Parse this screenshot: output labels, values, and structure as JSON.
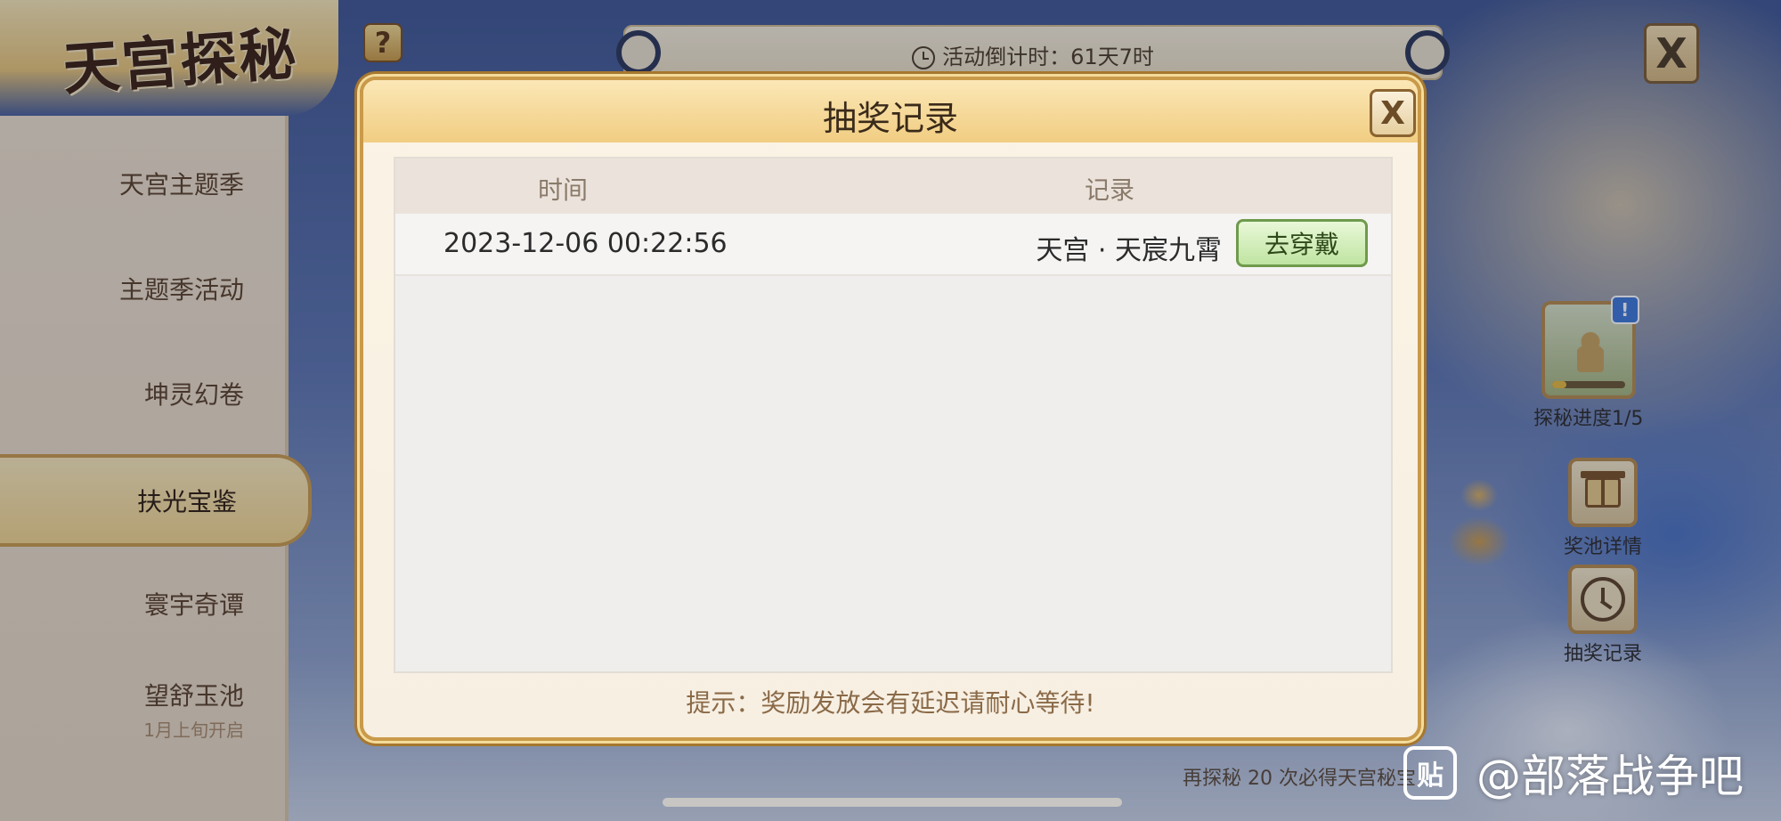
{
  "app": {
    "logo_text": "天宫探秘",
    "help_icon": "question-icon",
    "countdown": "活动倒计时：61天7时",
    "close_icon": "close-icon"
  },
  "sidebar": {
    "items": [
      {
        "label": "天宫主题季",
        "sub": "",
        "active": false
      },
      {
        "label": "主题季活动",
        "sub": "",
        "active": false
      },
      {
        "label": "坤灵幻卷",
        "sub": "",
        "active": false
      },
      {
        "label": "扶光宝鉴",
        "sub": "",
        "active": true
      },
      {
        "label": "寰宇奇谭",
        "sub": "",
        "active": false
      },
      {
        "label": "望舒玉池",
        "sub": "1月上旬开启",
        "active": false
      }
    ]
  },
  "right_panel": {
    "progress": {
      "label": "探秘进度1/5",
      "value": 0.2,
      "badge": "!"
    },
    "prize_pool": {
      "label": "奖池详情",
      "icon": "gift-icon"
    },
    "draw_record": {
      "label": "抽奖记录",
      "icon": "clock-icon"
    },
    "bottom_tip": "再探秘 20 次必得天宫秘宝"
  },
  "modal": {
    "title": "抽奖记录",
    "columns": {
      "time": "时间",
      "record": "记录"
    },
    "rows": [
      {
        "time": "2023-12-06 00:22:56",
        "record": "天宫 · 天宸九霄",
        "action": "去穿戴"
      }
    ],
    "tip": "提示：奖励发放会有延迟请耐心等待!"
  },
  "watermark": {
    "logo": "贴",
    "text": "@部落战争吧"
  },
  "colors": {
    "accent_gold": "#c99a4a",
    "wear_button_green": "#bfe4a1",
    "badge_blue": "#3d78d6"
  }
}
